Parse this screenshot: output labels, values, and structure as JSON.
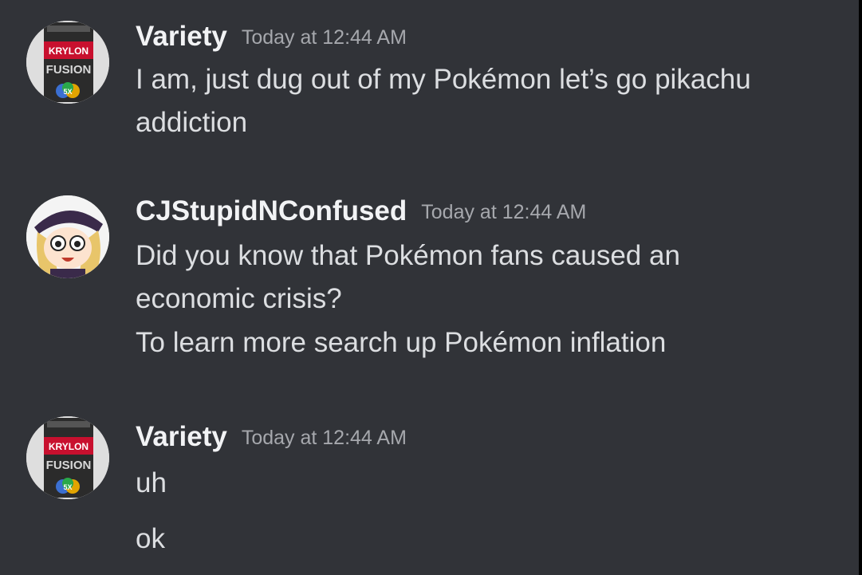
{
  "messages": [
    {
      "username": "Variety",
      "timestamp": "Today at 12:44 AM",
      "avatar": "krylon-fusion-spray-can-avatar",
      "lines": [
        "I am, just dug out of my Pokémon let’s go pikachu",
        "addiction"
      ]
    },
    {
      "username": "CJStupidNConfused",
      "timestamp": "Today at 12:44 AM",
      "avatar": "anime-character-avatar",
      "lines": [
        "Did you know that Pokémon fans caused an",
        "economic crisis?",
        "To learn more search up Pokémon inflation"
      ]
    },
    {
      "username": "Variety",
      "timestamp": "Today at 12:44 AM",
      "avatar": "krylon-fusion-spray-can-avatar",
      "lines": [
        "uh",
        "ok"
      ]
    }
  ],
  "avatar_text": {
    "brand": "KRYLON",
    "product": "FUSION",
    "badge": "5X"
  },
  "colors": {
    "background": "#313338",
    "username": "#f2f3f5",
    "timestamp": "#a6a8ad",
    "message_text": "#dcdee1"
  }
}
